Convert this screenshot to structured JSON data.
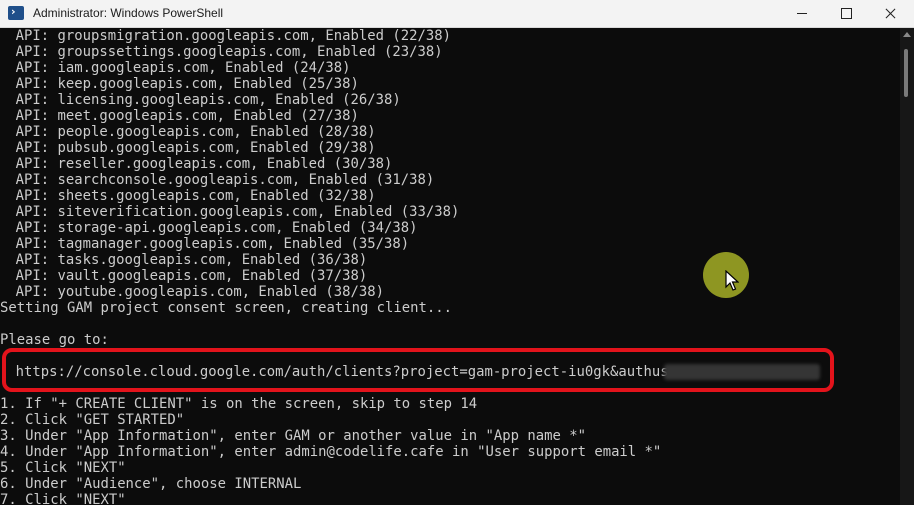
{
  "window": {
    "title": "Administrator: Windows PowerShell",
    "icon": "powershell-icon"
  },
  "console": {
    "lines": [
      "API: groupsmigration.googleapis.com, Enabled (22/38)",
      "API: groupssettings.googleapis.com, Enabled (23/38)",
      "API: iam.googleapis.com, Enabled (24/38)",
      "API: keep.googleapis.com, Enabled (25/38)",
      "API: licensing.googleapis.com, Enabled (26/38)",
      "API: meet.googleapis.com, Enabled (27/38)",
      "API: people.googleapis.com, Enabled (28/38)",
      "API: pubsub.googleapis.com, Enabled (29/38)",
      "API: reseller.googleapis.com, Enabled (30/38)",
      "API: searchconsole.googleapis.com, Enabled (31/38)",
      "API: sheets.googleapis.com, Enabled (32/38)",
      "API: siteverification.googleapis.com, Enabled (33/38)",
      "API: storage-api.googleapis.com, Enabled (34/38)",
      "API: tagmanager.googleapis.com, Enabled (35/38)",
      "API: tasks.googleapis.com, Enabled (36/38)",
      "API: vault.googleapis.com, Enabled (37/38)",
      "API: youtube.googleapis.com, Enabled (38/38)",
      "Setting GAM project consent screen, creating client...",
      "",
      "Please go to:",
      "",
      "https://console.cloud.google.com/auth/clients?project=gam-project-iu0gk&authuser=",
      "",
      "1. If \"+ CREATE CLIENT\" is on the screen, skip to step 14",
      "2. Click \"GET STARTED\"",
      "3. Under \"App Information\", enter GAM or another value in \"App name *\"",
      "4. Under \"App Information\", enter admin@codelife.cafe in \"User support email *\"",
      "5. Click \"NEXT\"",
      "6. Under \"Audience\", choose INTERNAL",
      "7. Click \"NEXT\""
    ]
  },
  "colors": {
    "console_bg": "#0c0c0c",
    "console_text": "#cccccc",
    "highlight": "#e3131b",
    "cursor_halo": "#afb928"
  }
}
